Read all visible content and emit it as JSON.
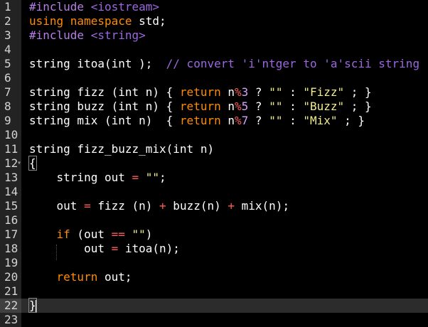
{
  "editor": {
    "lines": [
      {
        "n": "1",
        "parts": [
          [
            "inc",
            "#include "
          ],
          [
            "cmt",
            "<iostream>"
          ]
        ]
      },
      {
        "n": "2",
        "parts": [
          [
            "kw",
            "using namespace "
          ],
          [
            "",
            "std;"
          ]
        ]
      },
      {
        "n": "3",
        "parts": [
          [
            "inc",
            "#include "
          ],
          [
            "cmt",
            "<string>"
          ]
        ]
      },
      {
        "n": "4",
        "parts": []
      },
      {
        "n": "5",
        "parts": [
          [
            "",
            "string itoa(int );  "
          ],
          [
            "cmt",
            "// convert 'i'ntger to 'a'scii string"
          ]
        ]
      },
      {
        "n": "6",
        "parts": []
      },
      {
        "n": "7",
        "parts": [
          [
            "",
            "string fizz (int n) { "
          ],
          [
            "kw",
            "return "
          ],
          [
            "",
            "n"
          ],
          [
            "op",
            "%"
          ],
          [
            "num",
            "3"
          ],
          [
            "",
            " ? "
          ],
          [
            "str",
            "\"\""
          ],
          [
            "",
            " : "
          ],
          [
            "str",
            "\"Fizz\""
          ],
          [
            "",
            " ; }"
          ]
        ]
      },
      {
        "n": "8",
        "parts": [
          [
            "",
            "string buzz (int n) { "
          ],
          [
            "kw",
            "return "
          ],
          [
            "",
            "n"
          ],
          [
            "op",
            "%"
          ],
          [
            "num",
            "5"
          ],
          [
            "",
            " ? "
          ],
          [
            "str",
            "\"\""
          ],
          [
            "",
            " : "
          ],
          [
            "str",
            "\"Buzz\""
          ],
          [
            "",
            " ; }"
          ]
        ]
      },
      {
        "n": "9",
        "parts": [
          [
            "",
            "string mix (int n)  { "
          ],
          [
            "kw",
            "return "
          ],
          [
            "",
            "n"
          ],
          [
            "op",
            "%"
          ],
          [
            "num",
            "7"
          ],
          [
            "",
            " ? "
          ],
          [
            "str",
            "\"\""
          ],
          [
            "",
            " : "
          ],
          [
            "str",
            "\"Mix\""
          ],
          [
            "",
            " ; }"
          ]
        ]
      },
      {
        "n": "10",
        "parts": []
      },
      {
        "n": "11",
        "parts": [
          [
            "",
            "string fizz_buzz_mix(int n)"
          ]
        ]
      },
      {
        "n": "12",
        "fold": "▾",
        "parts": [
          [
            "bm",
            "{"
          ]
        ]
      },
      {
        "n": "13",
        "parts": [
          [
            "",
            "    string out "
          ],
          [
            "op",
            "="
          ],
          [
            "",
            " "
          ],
          [
            "str",
            "\"\""
          ],
          [
            "",
            ";"
          ]
        ]
      },
      {
        "n": "14",
        "parts": []
      },
      {
        "n": "15",
        "parts": [
          [
            "",
            "    out "
          ],
          [
            "op",
            "="
          ],
          [
            "",
            " fizz (n) "
          ],
          [
            "op",
            "+"
          ],
          [
            "",
            " buzz(n) "
          ],
          [
            "op",
            "+"
          ],
          [
            "",
            " mix(n);"
          ]
        ]
      },
      {
        "n": "16",
        "parts": []
      },
      {
        "n": "17",
        "parts": [
          [
            "",
            "    "
          ],
          [
            "kw",
            "if"
          ],
          [
            "",
            " (out "
          ],
          [
            "op",
            "=="
          ],
          [
            "",
            " "
          ],
          [
            "str",
            "\"\""
          ],
          [
            "",
            ")"
          ]
        ]
      },
      {
        "n": "18",
        "parts": [
          [
            "",
            "        out "
          ],
          [
            "op",
            "="
          ],
          [
            "",
            " itoa(n);"
          ]
        ]
      },
      {
        "n": "19",
        "parts": []
      },
      {
        "n": "20",
        "parts": [
          [
            "",
            "    "
          ],
          [
            "kw",
            "return"
          ],
          [
            "",
            " out;"
          ]
        ]
      },
      {
        "n": "21",
        "parts": []
      },
      {
        "n": "22",
        "active": true,
        "parts": [
          [
            "bm",
            "}"
          ]
        ]
      },
      {
        "n": "23",
        "parts": []
      }
    ]
  }
}
